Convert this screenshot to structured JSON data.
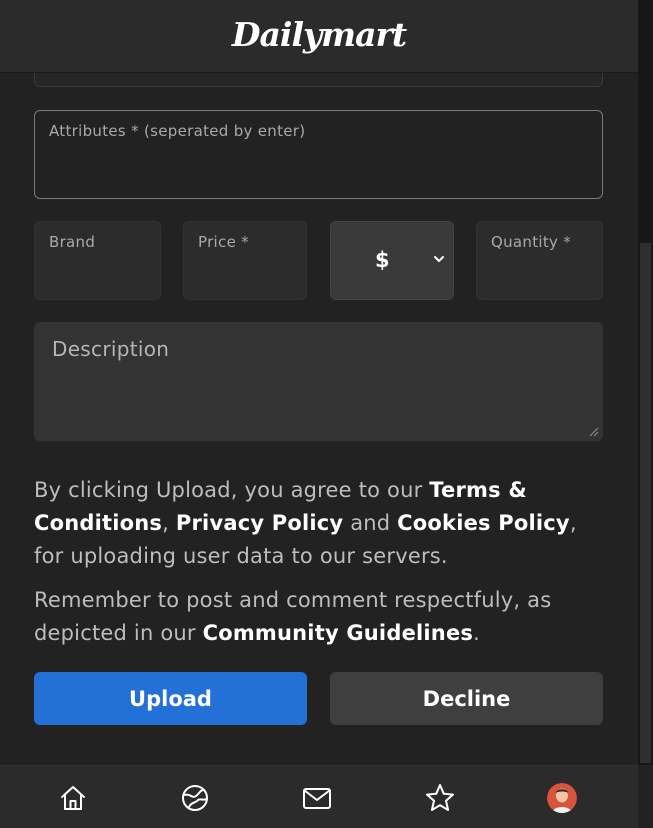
{
  "app": {
    "name": "Dailymart"
  },
  "form": {
    "attributes_label": "Attributes * (seperated by enter)",
    "brand_label": "Brand",
    "price_label": "Price *",
    "currency_selected": "$",
    "quantity_label": "Quantity *",
    "description_placeholder": "Description"
  },
  "agreement": {
    "prefix": "By clicking Upload, you agree to our ",
    "terms_link": "Terms & Conditions",
    "comma": ", ",
    "privacy_link": "Privacy Policy",
    "and": " and ",
    "cookies_link": "Cookies Policy",
    "suffix": ", for uploading user data to our servers."
  },
  "remember": {
    "prefix": "Remember to post and comment respectfuly, as depicted in our ",
    "guidelines_link": "Community Guidelines",
    "suffix": "."
  },
  "buttons": {
    "upload": "Upload",
    "decline": "Decline"
  },
  "colors": {
    "accent": "#2370d6",
    "background": "#222222",
    "surface": "#2c2c2c",
    "decline": "#3f3f3f"
  },
  "icons": {
    "nav": [
      "home-icon",
      "explore-icon",
      "mail-icon",
      "star-icon",
      "avatar"
    ],
    "currency_dropdown": "chevron-down-icon"
  }
}
